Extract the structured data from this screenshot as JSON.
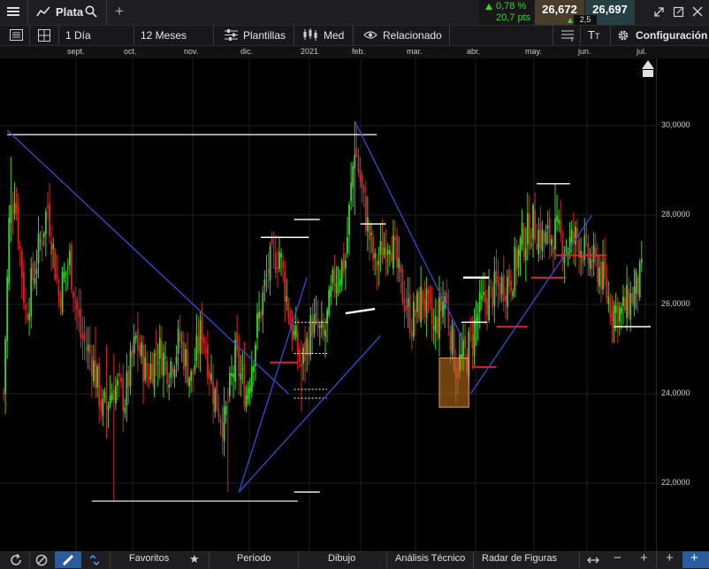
{
  "header": {
    "instrument": "Plata",
    "change_pct": "0,78 %",
    "change_pts": "20,7 pts",
    "sell_price": "26,672",
    "buy_price": "26,697",
    "spread": "2,5"
  },
  "toolbar": {
    "interval": "1 Día",
    "range": "12 Meses",
    "templates": "Plantillas",
    "price_type": "Med",
    "related": "Relacionado",
    "settings": "Configuración"
  },
  "bottom": {
    "favorites": "Favoritos",
    "period": "Período",
    "drawing": "Dibujo",
    "technical": "Análisis Técnico",
    "patterns": "Radar de Figuras"
  },
  "colors": {
    "up": "#3fd12a",
    "down": "#d8202a",
    "trend": "#3c49d6",
    "level": "#ffffff",
    "hl_red": "#e0262e",
    "box": "#c8781e"
  },
  "chart_data": {
    "type": "candlestick",
    "x_labels": [
      "sept.",
      "oct.",
      "nov.",
      "dic.",
      "2021",
      "feb.",
      "mar.",
      "abr.",
      "may.",
      "jun.",
      "jul."
    ],
    "y_ticks": [
      "22,0000",
      "24,0000",
      "26,0000",
      "28,0000",
      "30,0000"
    ],
    "ylim": [
      21.0,
      31.5
    ],
    "anchors": [
      [
        0,
        24.0
      ],
      [
        3,
        27.8
      ],
      [
        6,
        28.6
      ],
      [
        12,
        25.8
      ],
      [
        18,
        27.0
      ],
      [
        24,
        28.2
      ],
      [
        30,
        26.2
      ],
      [
        36,
        27.0
      ],
      [
        42,
        25.3
      ],
      [
        48,
        24.8
      ],
      [
        54,
        23.6
      ],
      [
        60,
        24.2
      ],
      [
        66,
        23.9
      ],
      [
        72,
        25.2
      ],
      [
        78,
        24.4
      ],
      [
        84,
        25.0
      ],
      [
        90,
        24.6
      ],
      [
        96,
        25.2
      ],
      [
        102,
        24.3
      ],
      [
        108,
        25.5
      ],
      [
        114,
        24.1
      ],
      [
        120,
        23.3
      ],
      [
        126,
        24.8
      ],
      [
        132,
        24.0
      ],
      [
        138,
        25.5
      ],
      [
        144,
        26.8
      ],
      [
        150,
        27.2
      ],
      [
        156,
        25.6
      ],
      [
        162,
        24.6
      ],
      [
        168,
        25.6
      ],
      [
        174,
        25.2
      ],
      [
        180,
        26.6
      ],
      [
        186,
        27.0
      ],
      [
        191,
        29.6
      ],
      [
        196,
        28.2
      ],
      [
        202,
        26.8
      ],
      [
        210,
        27.6
      ],
      [
        216,
        26.4
      ],
      [
        222,
        25.6
      ],
      [
        228,
        26.2
      ],
      [
        234,
        25.4
      ],
      [
        240,
        26.2
      ],
      [
        246,
        24.6
      ],
      [
        252,
        24.9
      ],
      [
        258,
        25.8
      ],
      [
        264,
        26.2
      ],
      [
        270,
        26.4
      ],
      [
        276,
        26.6
      ],
      [
        282,
        27.4
      ],
      [
        288,
        27.8
      ],
      [
        294,
        27.4
      ],
      [
        300,
        27.6
      ],
      [
        306,
        27.3
      ],
      [
        312,
        27.5
      ],
      [
        318,
        27.0
      ],
      [
        324,
        26.8
      ],
      [
        330,
        26.0
      ],
      [
        336,
        25.8
      ],
      [
        342,
        26.2
      ],
      [
        347,
        26.6
      ]
    ],
    "spikes": [
      {
        "i": 4,
        "high": 29.3,
        "low": 27.4
      },
      {
        "i": 50,
        "high": 25.5,
        "low": 23.9
      },
      {
        "i": 56,
        "high": 25.1,
        "low": 23.0
      },
      {
        "i": 60,
        "high": 24.9,
        "low": 21.6
      },
      {
        "i": 122,
        "high": 24.1,
        "low": 21.8
      },
      {
        "i": 162,
        "high": 25.2,
        "low": 23.6
      },
      {
        "i": 191,
        "high": 30.1,
        "low": 28.0
      },
      {
        "i": 246,
        "high": 25.0,
        "low": 23.8
      },
      {
        "i": 300,
        "high": 28.7,
        "low": 27.0
      }
    ],
    "horizontal_levels": [
      {
        "x0": 2,
        "x1": 203,
        "y": 29.8
      },
      {
        "x0": 48,
        "x1": 160,
        "y": 21.6
      },
      {
        "x0": 140,
        "x1": 166,
        "y": 27.5
      },
      {
        "x0": 158,
        "x1": 172,
        "y": 27.9
      },
      {
        "x0": 158,
        "x1": 172,
        "y": 21.8
      },
      {
        "x0": 194,
        "x1": 208,
        "y": 27.8
      },
      {
        "x0": 249,
        "x1": 263,
        "y": 25.6
      },
      {
        "x0": 290,
        "x1": 308,
        "y": 28.7
      },
      {
        "x0": 332,
        "x1": 352,
        "y": 25.5
      }
    ],
    "dotted_levels": [
      {
        "x0": 158,
        "x1": 176,
        "y": 25.6
      },
      {
        "x0": 158,
        "x1": 176,
        "y": 24.9
      },
      {
        "x0": 158,
        "x1": 176,
        "y": 24.1
      },
      {
        "x0": 158,
        "x1": 176,
        "y": 23.9
      }
    ],
    "short_levels": [
      {
        "x0": 186,
        "x1": 202,
        "y": 25.8,
        "y2": 25.9
      },
      {
        "x0": 250,
        "x1": 264,
        "y": 26.6
      }
    ],
    "red_levels": [
      {
        "x0": 145,
        "x1": 160,
        "y": 24.7
      },
      {
        "x0": 255,
        "x1": 268,
        "y": 24.6
      },
      {
        "x0": 268,
        "x1": 285,
        "y": 25.5
      },
      {
        "x0": 287,
        "x1": 306,
        "y": 26.6
      },
      {
        "x0": 300,
        "x1": 328,
        "y": 27.1
      }
    ],
    "trend_lines": [
      [
        2,
        29.9,
        155,
        24.0
      ],
      [
        128,
        21.8,
        165,
        26.6
      ],
      [
        128,
        21.8,
        205,
        25.3
      ],
      [
        191,
        30.1,
        250,
        25.2
      ],
      [
        254,
        24.0,
        320,
        28.0
      ]
    ],
    "box": {
      "i0": 237,
      "i1": 253,
      "top": 24.8,
      "bottom": 23.7
    }
  }
}
